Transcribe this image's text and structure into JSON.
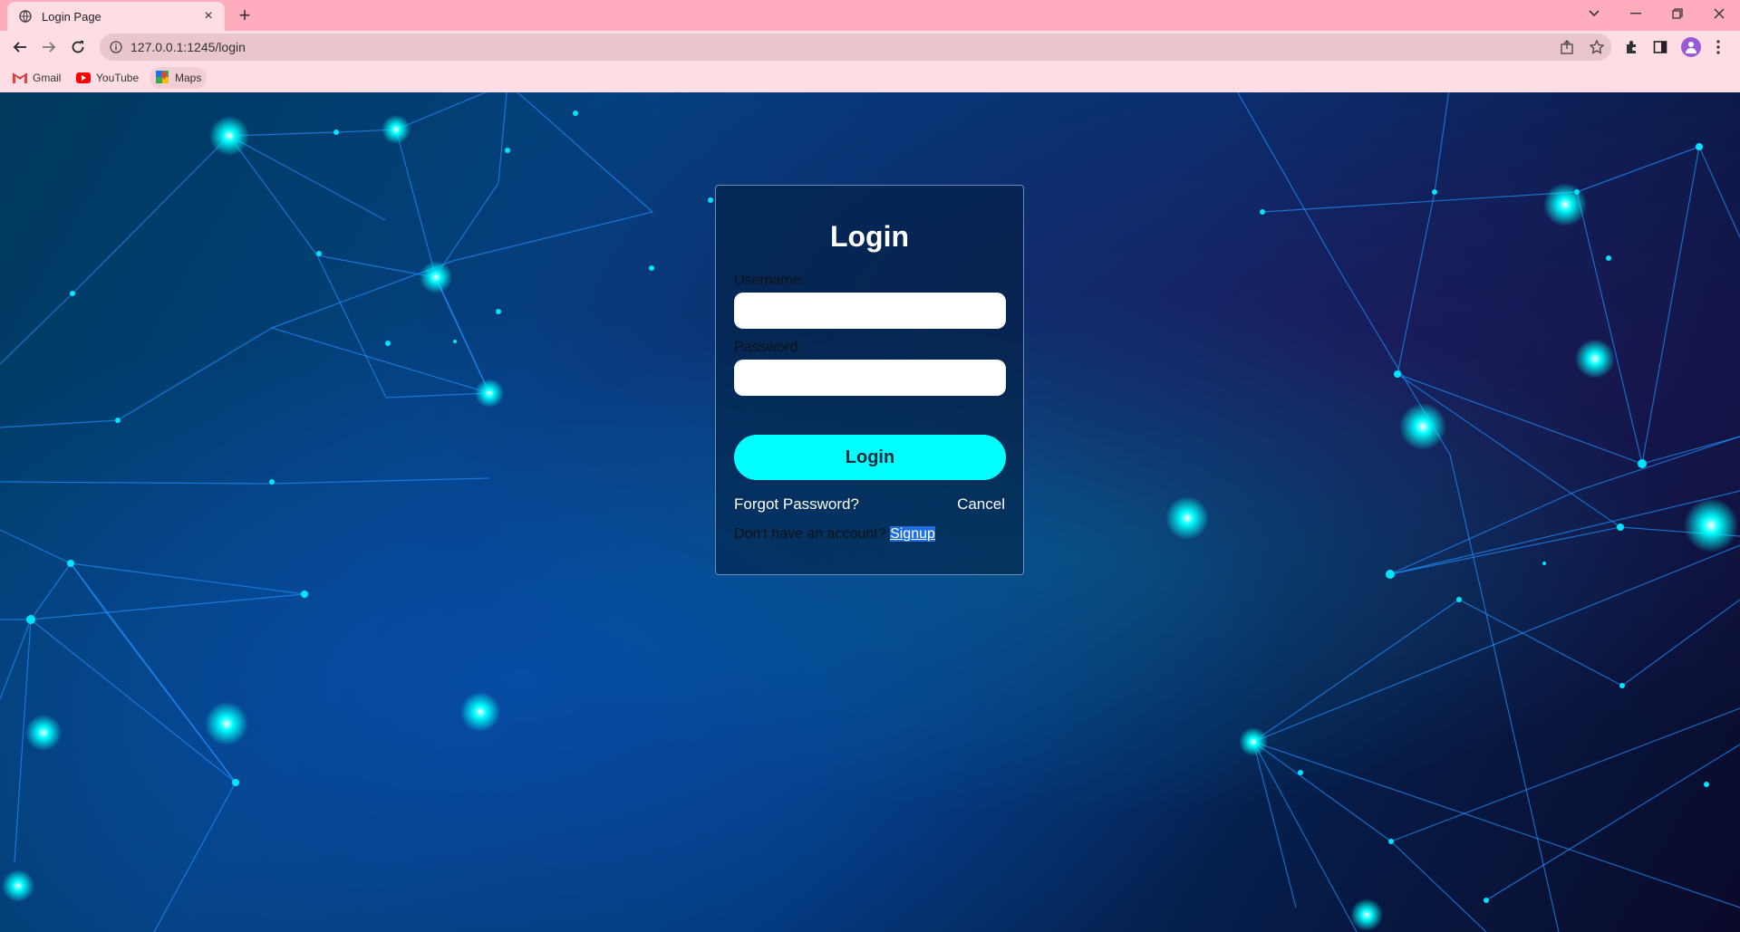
{
  "browser": {
    "tab_title": "Login Page",
    "tab_close": "×",
    "new_tab": "+",
    "url": "127.0.0.1:1245/login",
    "bookmarks": [
      {
        "label": "Gmail",
        "icon": "gmail-icon"
      },
      {
        "label": "YouTube",
        "icon": "youtube-icon"
      },
      {
        "label": "Maps",
        "icon": "maps-icon"
      }
    ],
    "colors": {
      "tabbar": "#ffadbe",
      "toolbar": "#ffdde4",
      "omnibox": "#e8c6cc"
    }
  },
  "login": {
    "title": "Login",
    "username_label": "Username:",
    "username_value": "",
    "password_label": "Password:",
    "password_value": "",
    "login_button": "Login",
    "forgot_password": "Forgot Password?",
    "cancel": "Cancel",
    "no_account_text": "Don't have an account?",
    "signup_link": "Signup",
    "colors": {
      "button": "#00ffff",
      "signup_highlight": "#1f6fe0"
    }
  }
}
